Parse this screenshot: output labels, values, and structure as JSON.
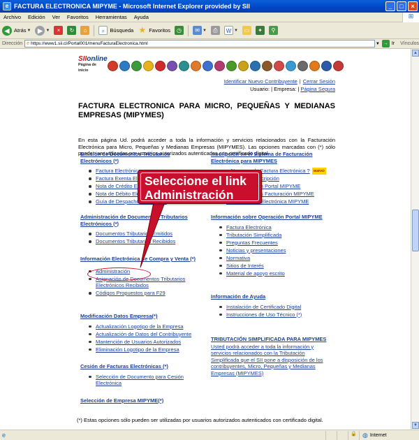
{
  "window": {
    "title": "FACTURA ELECTRONICA MIPYME - Microsoft Internet Explorer provided by SII",
    "buttons": [
      "minimize",
      "maximize",
      "close"
    ]
  },
  "menubar": {
    "items": [
      "Archivo",
      "Edición",
      "Ver",
      "Favoritos",
      "Herramientas",
      "Ayuda"
    ]
  },
  "toolbar": {
    "back_label": "Atrás",
    "search_label": "Búsqueda",
    "favorites_label": "Favoritos"
  },
  "address": {
    "label": "Dirección",
    "url": "https://www1.sii.cl/Portal001/menuFacturaElectronica.html",
    "go_label": "Ir",
    "links_label": "Vínculos"
  },
  "banner": {
    "logo_line1_a": "SII",
    "logo_line1_b": "online",
    "logo_line2": "Página de inicio",
    "icon_colors": [
      "#d23a2a",
      "#2d7bc4",
      "#3c9a3c",
      "#e8b21a",
      "#cf2b2b",
      "#7a4fb0",
      "#2b8f8f",
      "#e0792a",
      "#3f6fcf",
      "#b23c6e",
      "#4c9a2a",
      "#c9a21a",
      "#2a6faf",
      "#8b5a2b",
      "#d04a4a",
      "#3a9ad0",
      "#6a6a6a",
      "#e07a1a",
      "#2a5aa8",
      "#c23a3a"
    ]
  },
  "toplinks": {
    "identify": "Identificar Nuevo Contribuyente",
    "logout": "Cerrar Sesión",
    "user_label": "Usuario: | Empresa: |",
    "secure_page": "Página Segura"
  },
  "page": {
    "title": "FACTURA ELECTRONICA PARA MICRO, PEQUEÑAS Y MEDIANAS EMPRESAS (MIPYMES)",
    "intro": "En esta página Ud. podrá acceder a toda la información y servicios relacionados con la Facturación Electrónica para Micro, Pequeñas y Medianas Empresas (MIPYMES). Las opciones marcadas con (*) sólo pueden ser utilizadas por usuarios autorizados autenticados con certificado digital."
  },
  "left_sections": [
    {
      "heading": "Emisión de Documentos Tributarios Electrónicos (*)",
      "items": [
        "Factura Electrónica",
        "Factura Exenta Electrónica",
        "Nota de Crédito Electrónica",
        "Nota de Débito Electrónica",
        "Guía de Despacho Electrónica"
      ]
    },
    {
      "heading": "Administración de Documentos Tributarios Electrónicos (*)",
      "items": [
        "Documentos Tributarios Emitidos",
        "Documentos Tributarios Recibidos"
      ]
    },
    {
      "heading": "Información Electrónica de Compra y Venta (*)",
      "items": [
        "Administración",
        "Asignación de Documentos Tributarios Electrónicos Recibidos",
        "Códigos Propuestos para F29"
      ]
    },
    {
      "heading": "Modificación Datos Empresa(*)",
      "items": [
        "Actualización Logotipo de la Empresa",
        "Actualización de Datos del Contribuyente",
        "Mantención de Usuarios Autorizados",
        "Eliminación Logotipo de la Empresa"
      ]
    },
    {
      "heading": "Cesión de Facturas Electrónicas (*)",
      "items": [
        "Selección de Documento para Cesión Electrónica"
      ]
    },
    {
      "heading": "Selección de Empresa MIPYME(*)",
      "items": []
    }
  ],
  "right_sections": [
    {
      "heading": "Inscripción en el Sistema de Facturación Electrónica para MIPYMES",
      "items": [
        "¿ Nuevo en la Factura Electrónica ?",
        "Factibilidad/Inscripción",
        "Guía Operación Portal MIPYME",
        "Guías Prácticas Facturación MIPYME",
        "Demo Factura Electrónica MIPYME"
      ],
      "new_badge": "NUEVO"
    },
    {
      "heading": "Información sobre Operación Portal MIPYME",
      "items": [
        "Factura Electrónica",
        "Tributación Simplificada",
        "Preguntas Frecuentes",
        "Noticias y presentaciones",
        "Normativa",
        "Sitios de Interés",
        "Material de apoyo escrito"
      ]
    },
    {
      "heading": "Información de Ayuda",
      "items": [
        "Instalación de Certificado Digital",
        "Instrucciones de Uso Técnico (*)"
      ]
    },
    {
      "heading": "TRIBUTACIÓN SIMPLIFICADA PARA MIPYMES",
      "body": "Usted podrá acceder a toda la información y servicios relacionados con la Tributación Simplificada que el SII pone a disposición de los contribuyentes, Micro, Pequeñas y Medianas Empresas (MIPYMES)"
    }
  ],
  "footnote": "(*) Estas opciones sólo pueden ser utilizadas por usuarios autorizados autenticados con certificado digital.",
  "callout": {
    "line1": "Seleccione el link",
    "line2": "Administración"
  },
  "statusbar": {
    "zone": "Internet"
  }
}
